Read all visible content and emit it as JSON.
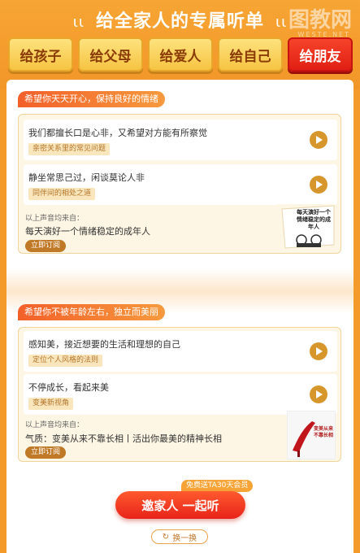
{
  "header": {
    "title": "给全家人的专属听单",
    "deco_left": "ιι",
    "deco_right": "ιι",
    "watermark": "图教网",
    "watermark_sub": "WESTE.NET"
  },
  "tabs": [
    {
      "label": "给孩子",
      "active": false
    },
    {
      "label": "给父母",
      "active": false
    },
    {
      "label": "给爱人",
      "active": false
    },
    {
      "label": "给自己",
      "active": false
    },
    {
      "label": "给朋友",
      "active": true
    }
  ],
  "sections": [
    {
      "tag": "希望你天天开心，保持良好的情绪",
      "items": [
        {
          "title": "我们都擅长口是心非，又希望对方能有所察觉",
          "tag": "亲密关系里的常见问题"
        },
        {
          "title": "静坐常思己过，闲谈莫论人非",
          "tag": "同伴间的相处之道"
        }
      ],
      "source_label": "以上声音均来自：",
      "source_title": "每天演好一个情绪稳定的成年人",
      "subscribe_label": "立即订阅",
      "cover_text": "每天演好一个情绪稳定的成年人"
    },
    {
      "tag": "希望你不被年龄左右，独立而美丽",
      "items": [
        {
          "title": "感知美，接近想要的生活和理想的自己",
          "tag": "定位个人风格的法则"
        },
        {
          "title": "不停成长，看起来美",
          "tag": "变美新视角"
        }
      ],
      "source_label": "以上声音均来自：",
      "source_title": "气质：变美从来不靠长相丨活出你最美的精神长相",
      "subscribe_label": "立即订阅",
      "cover_text": "变美从来不靠长相"
    }
  ],
  "invite": {
    "badge": "免费送TA30天会员",
    "button_label": "邀家人 一起听"
  },
  "refresh": {
    "icon": "refresh-icon",
    "label": "换一换"
  },
  "colors": {
    "brand_orange": "#f39a2b",
    "active_tab": "#e11f14",
    "play_button": "#d7962b"
  }
}
